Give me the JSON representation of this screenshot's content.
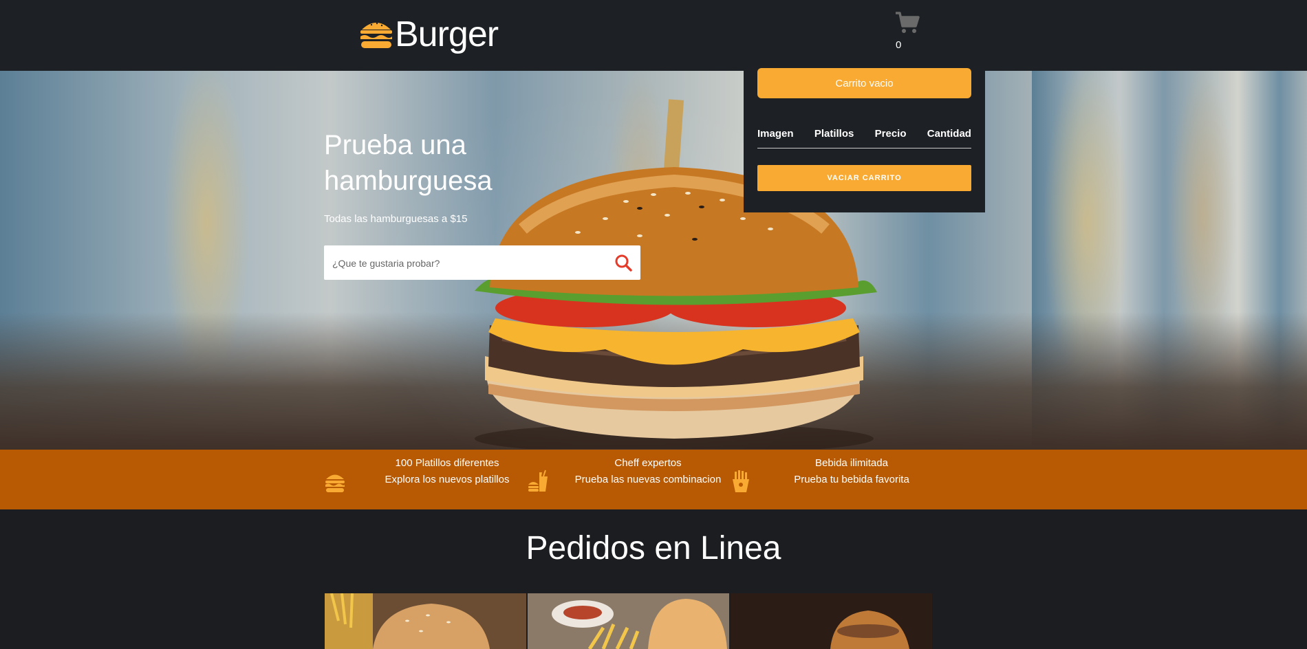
{
  "header": {
    "logo_text": "Burger",
    "cart_count": "0"
  },
  "hero": {
    "title": "Prueba una hamburguesa",
    "subtitle": "Todas las hamburguesas a $15",
    "search_placeholder": "¿Que te gustaria probar?"
  },
  "cart": {
    "empty_label": "Carrito vacio",
    "columns": [
      "Imagen",
      "Platillos",
      "Precio",
      "Cantidad"
    ],
    "clear_label": "VACIAR CARRITO"
  },
  "features": [
    {
      "icon": "burger-icon",
      "title": "100 Platillos diferentes",
      "text": "Explora los nuevos platillos"
    },
    {
      "icon": "fast-food-icon",
      "title": "Cheff expertos",
      "text": "Prueba las nuevas combinacion"
    },
    {
      "icon": "fries-icon",
      "title": "Bebida ilimitada",
      "text": "Prueba tu bebida favorita"
    }
  ],
  "section": {
    "title": "Pedidos en Linea"
  },
  "colors": {
    "accent": "#f8aa32",
    "band": "#b85a04",
    "dark": "#1d2024"
  }
}
